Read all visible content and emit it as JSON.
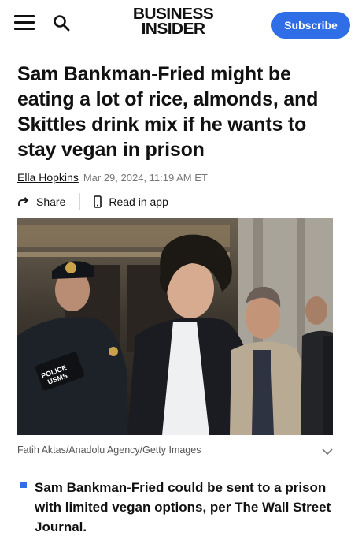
{
  "header": {
    "logo_line1": "BUSINESS",
    "logo_line2": "INSIDER",
    "subscribe_label": "Subscribe",
    "accent_color": "#2f6ee6",
    "menu_icon": "hamburger-menu-icon",
    "search_icon": "search-icon"
  },
  "article": {
    "headline": "Sam Bankman-Fried might be eating a lot of rice, almonds, and Skittles drink mix if he wants to stay vegan in prison",
    "author": "Ella Hopkins",
    "date": "Mar 29, 2024, 11:19 AM ET",
    "share_label": "Share",
    "read_in_app_label": "Read in app",
    "share_icon": "share-arrow-icon",
    "app_icon": "phone-icon"
  },
  "photo": {
    "caption": "Fatih Aktas/Anadolu Agency/Getty Images",
    "badge_line1": "POLICE",
    "badge_line2": "USMS"
  },
  "key_points": [
    "Sam Bankman-Fried could be sent to a prison with limited vegan options, per The Wall Street Journal."
  ]
}
